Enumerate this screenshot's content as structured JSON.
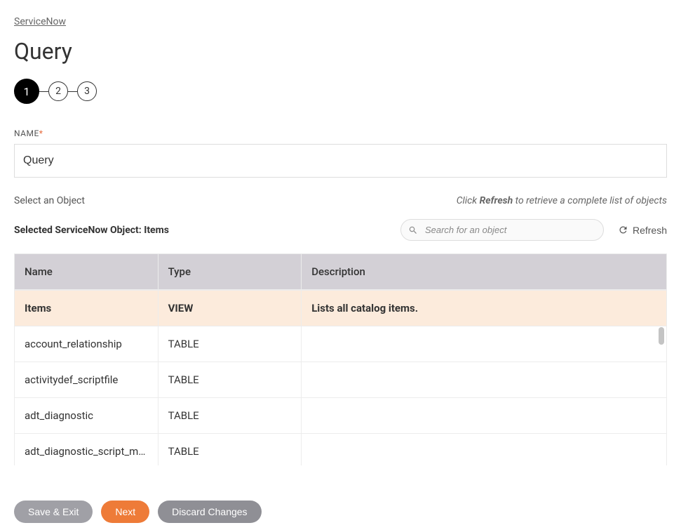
{
  "breadcrumb": {
    "label": "ServiceNow"
  },
  "page": {
    "title": "Query"
  },
  "stepper": {
    "steps": [
      "1",
      "2",
      "3"
    ],
    "active": 0
  },
  "nameField": {
    "label": "NAME",
    "value": "Query"
  },
  "selectObject": {
    "label": "Select an Object",
    "hintPrefix": "Click ",
    "hintBold": "Refresh",
    "hintSuffix": " to retrieve a complete list of objects"
  },
  "selectedObject": {
    "labelPrefix": "Selected ServiceNow Object: ",
    "value": "Items"
  },
  "search": {
    "placeholder": "Search for an object"
  },
  "refresh": {
    "label": "Refresh"
  },
  "table": {
    "headers": {
      "name": "Name",
      "type": "Type",
      "description": "Description"
    },
    "rows": [
      {
        "name": "Items",
        "type": "VIEW",
        "description": "Lists all catalog items.",
        "selected": true
      },
      {
        "name": "account_relationship",
        "type": "TABLE",
        "description": "",
        "selected": false
      },
      {
        "name": "activitydef_scriptfile",
        "type": "TABLE",
        "description": "",
        "selected": false
      },
      {
        "name": "adt_diagnostic",
        "type": "TABLE",
        "description": "",
        "selected": false
      },
      {
        "name": "adt_diagnostic_script_map...",
        "type": "TABLE",
        "description": "",
        "selected": false
      }
    ]
  },
  "buttons": {
    "save": "Save & Exit",
    "next": "Next",
    "discard": "Discard Changes"
  }
}
